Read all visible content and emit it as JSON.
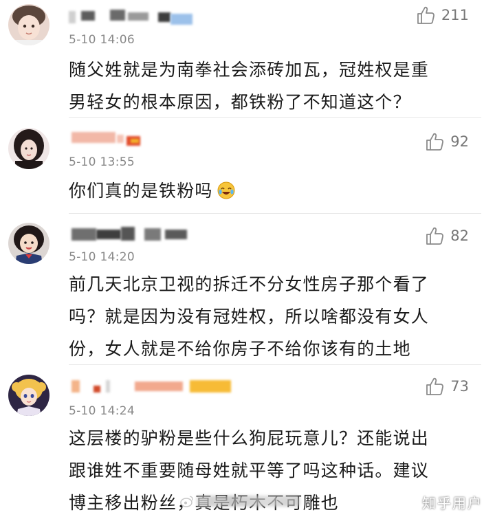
{
  "comments": [
    {
      "time": "5-10 14:06",
      "likes": "211",
      "text_lines": [
        "随父姓就是为南拳社会添砖加瓦，冠姓权是重",
        "男轻女的根本原因，都铁粉了不知道这个？"
      ]
    },
    {
      "time": "5-10 13:55",
      "likes": "92",
      "text_lines": [
        "你们真的是铁粉吗"
      ],
      "emoji": "laughing-crying-emoji"
    },
    {
      "time": "5-10 14:20",
      "likes": "82",
      "text_lines": [
        "前几天北京卫视的拆迁不分女性房子那个看了",
        "吗？就是因为没有冠姓权，所以啥都没有女人",
        "份，女人就是不给你房子不给你该有的土地"
      ]
    },
    {
      "time": "5-10 14:24",
      "likes": "73",
      "text_lines": [
        "这层楼的驴粉是些什么狗屁玩意儿？还能说出",
        "跟谁姓不重要随母姓就平等了吗这种话。建议",
        "博主移出粉丝，真是朽木不可雕也"
      ]
    }
  ],
  "watermark": {
    "right": "知乎用户",
    "center_icon": "weibo-icon"
  },
  "colors": {
    "time": "#888888",
    "text": "#1a1a1a",
    "divider": "#e8e8e8",
    "like_icon": "#8a8a8a"
  }
}
